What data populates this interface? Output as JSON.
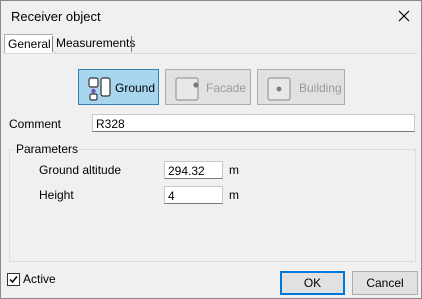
{
  "window": {
    "title": "Receiver object",
    "close_icon": "close-icon"
  },
  "tabs": [
    {
      "label": "General",
      "active": true
    },
    {
      "label": "Measurements",
      "active": false
    }
  ],
  "mode_buttons": [
    {
      "label": "Ground",
      "icon": "ground-icon",
      "selected": true,
      "enabled": true
    },
    {
      "label": "Facade",
      "icon": "facade-icon",
      "selected": false,
      "enabled": false
    },
    {
      "label": "Building",
      "icon": "building-icon",
      "selected": false,
      "enabled": false
    }
  ],
  "comment": {
    "label": "Comment",
    "value": "R328"
  },
  "parameters": {
    "legend": "Parameters",
    "ground_altitude": {
      "label": "Ground altitude",
      "value": "294.32",
      "unit": "m"
    },
    "height": {
      "label": "Height",
      "value": "4",
      "unit": "m"
    }
  },
  "active": {
    "label": "Active",
    "checked": true
  },
  "buttons": {
    "ok": "OK",
    "cancel": "Cancel"
  },
  "colors": {
    "selected_button": "#a9d6ef",
    "default_border": "#0078d7"
  }
}
